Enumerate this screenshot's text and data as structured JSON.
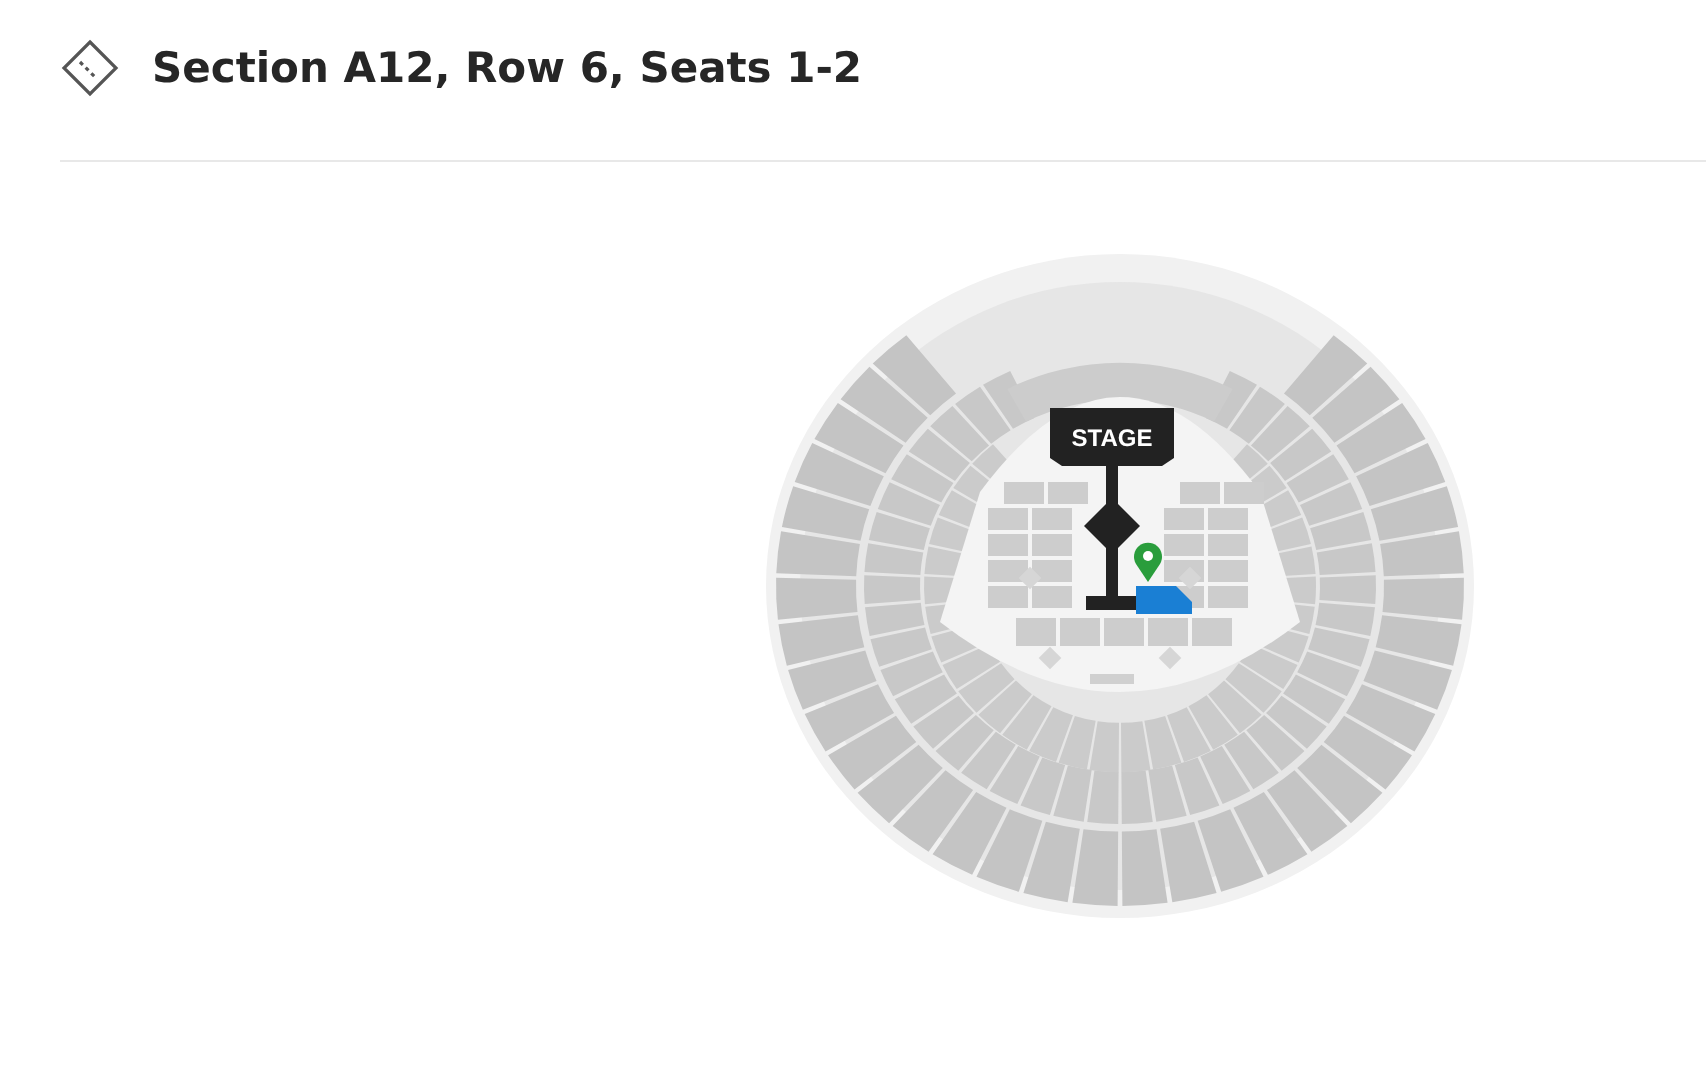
{
  "header": {
    "title": "Section A12, Row 6, Seats 1-2"
  },
  "map": {
    "stage_label": "STAGE"
  }
}
